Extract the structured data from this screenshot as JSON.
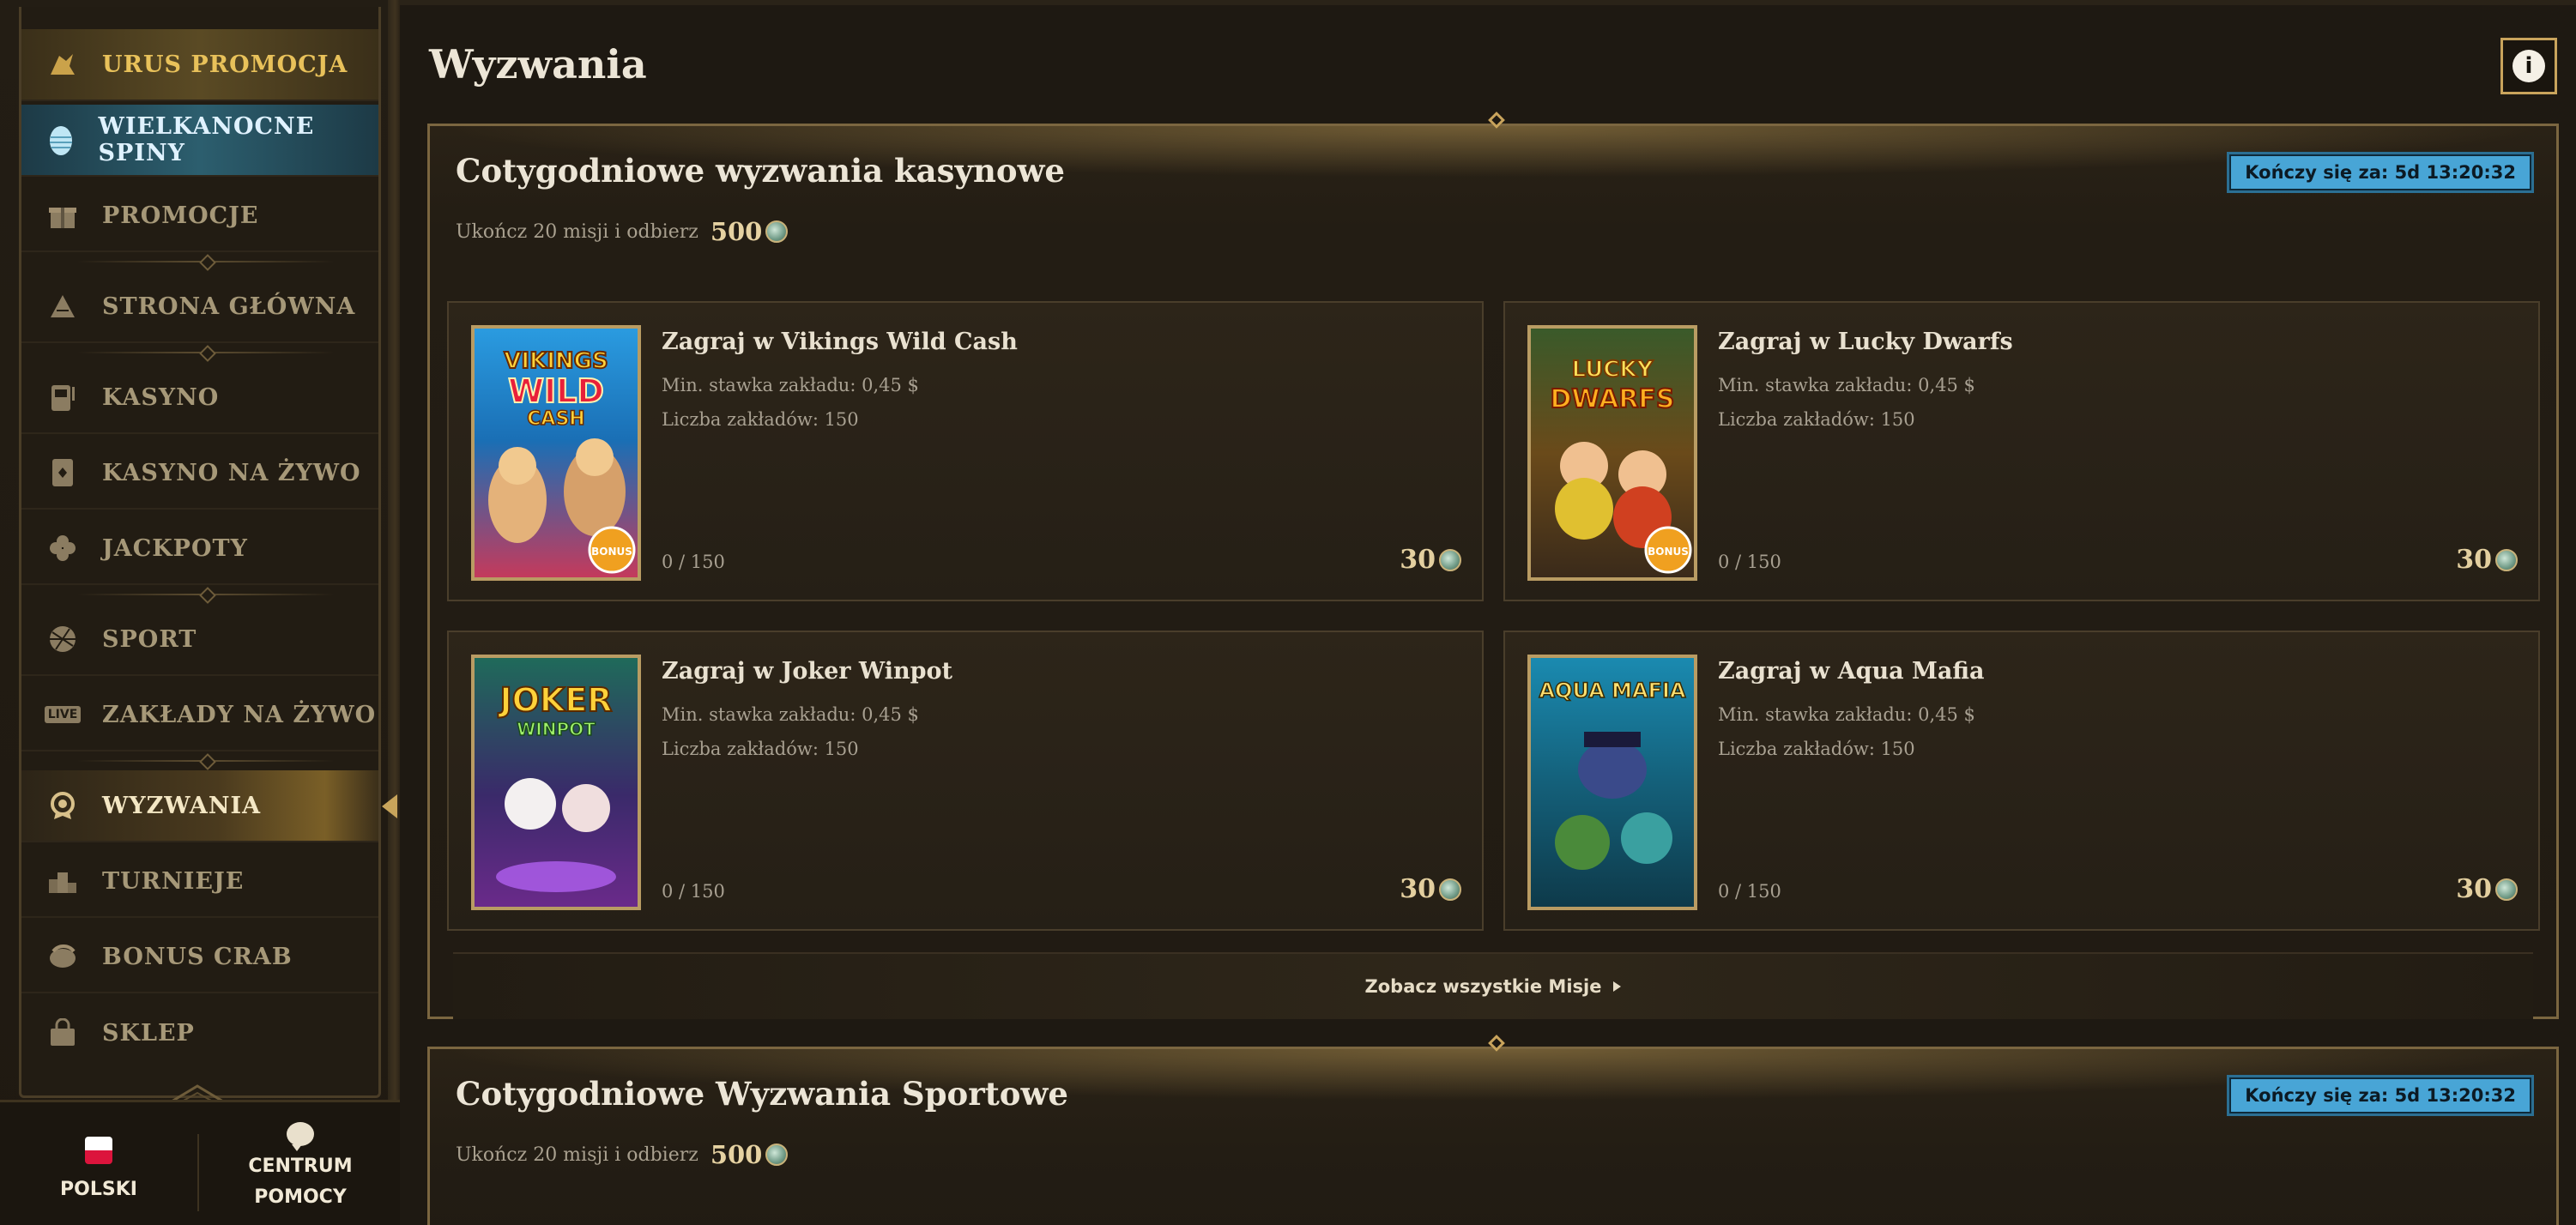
{
  "sidebar": {
    "items": [
      {
        "label": "URUS PROMOCJA",
        "icon": "bull-icon"
      },
      {
        "label": "WIELKANOCNE SPINY",
        "icon": "easter-egg-icon"
      },
      {
        "label": "PROMOCJE",
        "icon": "gift-icon"
      },
      {
        "label": "STRONA GŁÓWNA",
        "icon": "home-icon"
      },
      {
        "label": "KASYNO",
        "icon": "slot-machine-icon"
      },
      {
        "label": "KASYNO NA ŻYWO",
        "icon": "card-icon"
      },
      {
        "label": "JACKPOTY",
        "icon": "clover-icon"
      },
      {
        "label": "SPORT",
        "icon": "ball-icon"
      },
      {
        "label": "ZAKŁADY NA ŻYWO",
        "icon": "live-icon"
      },
      {
        "label": "WYZWANIA",
        "icon": "badge-icon"
      },
      {
        "label": "TURNIEJE",
        "icon": "podium-icon"
      },
      {
        "label": "BONUS CRAB",
        "icon": "crab-icon"
      },
      {
        "label": "SKLEP",
        "icon": "bag-icon"
      }
    ],
    "live_badge": "LIVE",
    "language": "POLSKI",
    "help_line1": "CENTRUM",
    "help_line2": "POMOCY"
  },
  "page": {
    "title": "Wyzwania",
    "info_icon": "i"
  },
  "casino_section": {
    "title": "Cotygodniowe wyzwania kasynowe",
    "subtitle": "Ukończ 20 misji i odbierz",
    "reward": "500",
    "timer": "Kończy się za: 5d 13:20:32",
    "missions": [
      {
        "title": "Zagraj w Vikings Wild Cash",
        "min_bet": "Min. stawka zakładu: 0,45 $",
        "count": "Liczba zakładów: 150",
        "progress": "0 / 150",
        "reward": "30",
        "game_art": "VIKINGS WILD CASH"
      },
      {
        "title": "Zagraj w Lucky Dwarfs",
        "min_bet": "Min. stawka zakładu: 0,45 $",
        "count": "Liczba zakładów: 150",
        "progress": "0 / 150",
        "reward": "30",
        "game_art": "LUCKY DWARFS"
      },
      {
        "title": "Zagraj w Joker Winpot",
        "min_bet": "Min. stawka zakładu: 0,45 $",
        "count": "Liczba zakładów: 150",
        "progress": "0 / 150",
        "reward": "30",
        "game_art": "JOKER WINPOT"
      },
      {
        "title": "Zagraj w Aqua Mafia",
        "min_bet": "Min. stawka zakładu: 0,45 $",
        "count": "Liczba zakładów: 150",
        "progress": "0 / 150",
        "reward": "30",
        "game_art": "AQUA MAFIA"
      }
    ],
    "see_all": "Zobacz wszystkie Misje"
  },
  "sport_section": {
    "title": "Cotygodniowe Wyzwania Sportowe",
    "subtitle": "Ukończ 20 misji i odbierz",
    "reward": "500",
    "timer": "Kończy się za: 5d 13:20:32"
  }
}
